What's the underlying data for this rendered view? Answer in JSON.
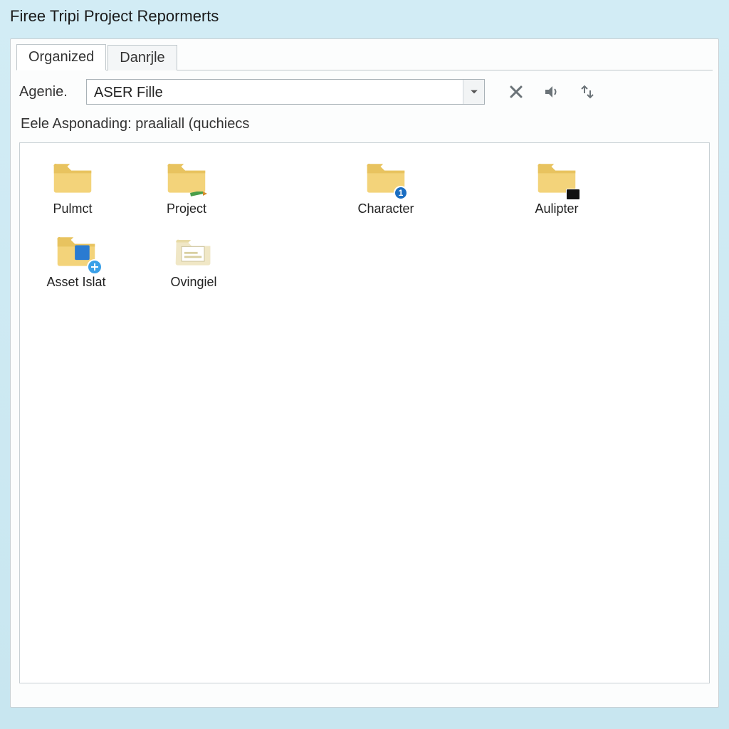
{
  "window": {
    "title": "Firee Tripi Project Repormerts"
  },
  "tabs": [
    {
      "label": "Organized",
      "active": true
    },
    {
      "label": "Danrjle",
      "active": false
    }
  ],
  "toolbar": {
    "label": "Agenie.",
    "dropdown_value": "ASER Fille",
    "icons": {
      "close": "close-icon",
      "volume": "volume-icon",
      "transfer": "transfer-icon"
    }
  },
  "status_text": "Eele Asponading: praaliall (quchiecs",
  "folders": [
    {
      "name": "Pulmct",
      "variant": "plain"
    },
    {
      "name": "Project",
      "variant": "pencil"
    },
    {
      "name": "Character",
      "variant": "badge-number",
      "badge": "1"
    },
    {
      "name": "Aulipter",
      "variant": "badge-dark"
    },
    {
      "name": "Asset Islat",
      "variant": "badge-plus"
    },
    {
      "name": "Ovingiel",
      "variant": "open"
    }
  ]
}
